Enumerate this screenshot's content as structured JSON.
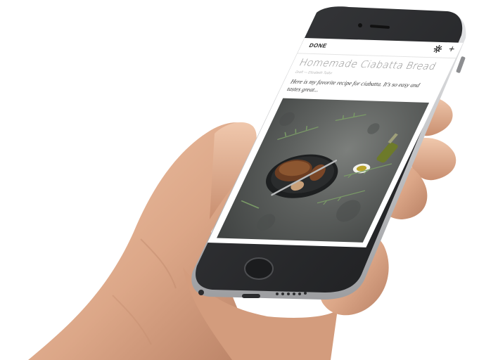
{
  "toolbar": {
    "done_label": "DONE",
    "settings_icon": "gear-icon",
    "add_icon": "plus-icon",
    "add_glyph": "+"
  },
  "post": {
    "title": "Homemade Ciabatta Bread",
    "meta": "Draft — Elizabeth Tudor",
    "excerpt": "Here is my favorite recipe for ciabatta. It's so easy and tastes great..."
  },
  "colors": {
    "phone_body": "#2b2c2e",
    "phone_frame": "#c9cacc",
    "screen_bg": "#ffffff",
    "skin": "#e2b497"
  }
}
